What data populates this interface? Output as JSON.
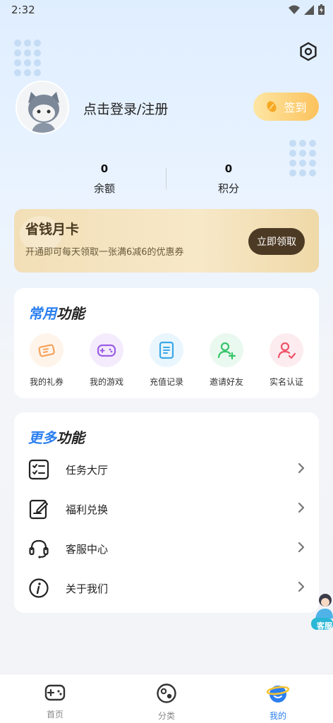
{
  "status_bar": {
    "time": "2:32"
  },
  "profile": {
    "login_text": "点击登录/注册",
    "sign_in_label": "签到"
  },
  "stats": [
    {
      "value": "0",
      "label": "余额"
    },
    {
      "value": "0",
      "label": "积分"
    }
  ],
  "month_card": {
    "title": "省钱月卡",
    "description": "开通即可每天领取一张满6减6的优惠券",
    "button": "立即领取"
  },
  "common": {
    "title_highlight": "常用",
    "title_rest": "功能",
    "items": [
      {
        "label": "我的礼券",
        "icon": "ticket-icon",
        "color": "#f4a25a"
      },
      {
        "label": "我的游戏",
        "icon": "gamepad-icon",
        "color": "#9b5de5"
      },
      {
        "label": "充值记录",
        "icon": "document-icon",
        "color": "#3aa7e8"
      },
      {
        "label": "邀请好友",
        "icon": "add-user-icon",
        "color": "#35c46a"
      },
      {
        "label": "实名认证",
        "icon": "verified-user-icon",
        "color": "#f0536a"
      }
    ]
  },
  "more": {
    "title_highlight": "更多",
    "title_rest": "功能",
    "items": [
      {
        "label": "任务大厅",
        "icon": "task-list-icon"
      },
      {
        "label": "福利兑换",
        "icon": "edit-document-icon"
      },
      {
        "label": "客服中心",
        "icon": "headset-icon"
      },
      {
        "label": "关于我们",
        "icon": "info-icon"
      }
    ]
  },
  "float_service": {
    "label": "客服"
  },
  "tabbar": [
    {
      "label": "首页",
      "icon": "gamepad-icon"
    },
    {
      "label": "分类",
      "icon": "category-icon"
    },
    {
      "label": "我的",
      "icon": "planet-icon",
      "active": true
    }
  ],
  "colors": {
    "accent": "#2b7ff0",
    "gold": "#fcc25c",
    "card_button": "#4d3a24"
  }
}
